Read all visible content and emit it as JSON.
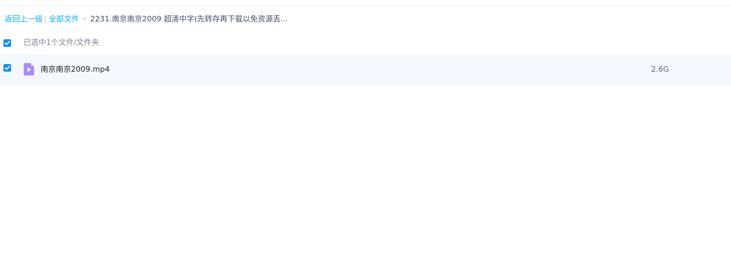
{
  "breadcrumb": {
    "back_label": "返回上一级",
    "separator": "|",
    "root_label": "全部文件",
    "arrow": "»",
    "current_folder": "2231.南京南京2009 超清中字(先转存再下载以免资源丢..."
  },
  "selection": {
    "summary": "已选中1个文件/文件夹",
    "select_all_checked": true
  },
  "files": [
    {
      "name": "南京南京2009.mp4",
      "size": "2.6G",
      "type_icon": "video-file-icon",
      "checked": true
    }
  ],
  "colors": {
    "link": "#09aaff",
    "checkbox": "#0b8cff",
    "row_selected_bg": "#f3f9ff",
    "video_icon": "#a78bfa"
  }
}
